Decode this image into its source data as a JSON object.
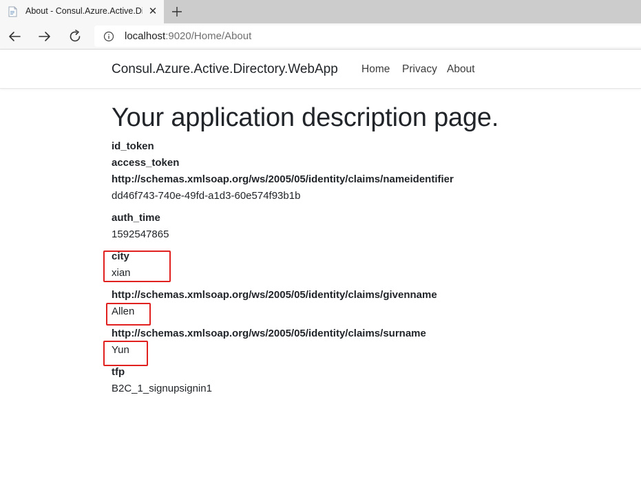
{
  "browser": {
    "tab": {
      "title": "About - Consul.Azure.Active.Dire",
      "close_glyph": "✕",
      "favicon": "page-icon"
    },
    "new_tab_icon": "plus-icon",
    "nav": {
      "back_icon": "arrow-left-icon",
      "forward_icon": "arrow-right-icon",
      "refresh_icon": "refresh-icon"
    },
    "address": {
      "host": "localhost",
      "rest": ":9020/Home/About",
      "info_icon": "info-icon"
    }
  },
  "site": {
    "brand": "Consul.Azure.Active.Directory.WebApp",
    "nav": {
      "home": "Home",
      "privacy": "Privacy",
      "about": "About"
    }
  },
  "main": {
    "title": "Your application description page.",
    "claims": [
      {
        "key": "id_token",
        "value": ""
      },
      {
        "key": "access_token",
        "value": ""
      },
      {
        "key": "http://schemas.xmlsoap.org/ws/2005/05/identity/claims/nameidentifier",
        "value": "dd46f743-740e-49fd-a1d3-60e574f93b1b"
      },
      {
        "key": "auth_time",
        "value": "1592547865"
      },
      {
        "key": "city",
        "value": "xian"
      },
      {
        "key": "http://schemas.xmlsoap.org/ws/2005/05/identity/claims/givenname",
        "value": "Allen"
      },
      {
        "key": "http://schemas.xmlsoap.org/ws/2005/05/identity/claims/surname",
        "value": "Yun"
      },
      {
        "key": "tfp",
        "value": "B2C_1_signupsignin1"
      }
    ]
  },
  "colors": {
    "annotation_red": "#e0201e",
    "tab_strip": "#cccccc",
    "toolbar": "#f7f7f7"
  }
}
